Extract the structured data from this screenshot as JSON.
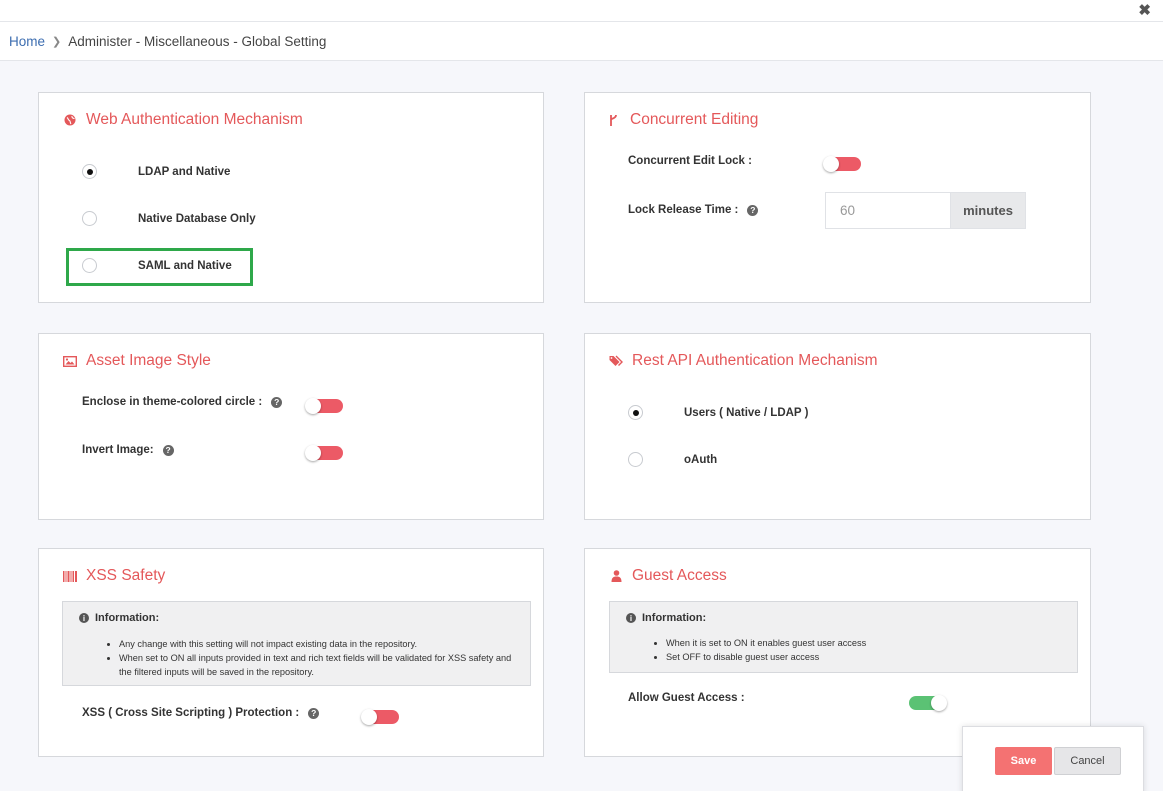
{
  "breadcrumb": {
    "home": "Home",
    "current": "Administer - Miscellaneous - Global Setting"
  },
  "icons": {
    "close": "close-icon",
    "web_auth": "globe-icon",
    "concurrent": "code-fork-icon",
    "asset_image": "image-icon",
    "rest_api": "tags-icon",
    "xss": "barcode-icon",
    "guest": "user-icon",
    "help": "question-circle-icon",
    "info": "info-circle-icon"
  },
  "colors": {
    "accent": "#e4585a",
    "toggle_off": "#ec5a66",
    "toggle_on": "#5bc274",
    "highlight": "#2ea84a",
    "save": "#f47272",
    "link": "#3c6db0"
  },
  "web_auth": {
    "title": "Web Authentication Mechanism",
    "options": [
      {
        "label": "LDAP and Native",
        "checked": true
      },
      {
        "label": "Native Database Only",
        "checked": false
      },
      {
        "label": "SAML and Native",
        "checked": false
      }
    ]
  },
  "concurrent": {
    "title": "Concurrent Editing",
    "lock_label": "Concurrent Edit Lock :",
    "lock_on": false,
    "release_label": "Lock Release Time :",
    "release_value": "60",
    "release_unit": "minutes"
  },
  "asset_image": {
    "title": "Asset Image Style",
    "enclose_label": "Enclose in theme-colored circle :",
    "enclose_on": false,
    "invert_label": "Invert Image:",
    "invert_on": false
  },
  "rest_api": {
    "title": "Rest API Authentication Mechanism",
    "options": [
      {
        "label": "Users ( Native / LDAP )",
        "checked": true
      },
      {
        "label": "oAuth",
        "checked": false
      }
    ]
  },
  "xss": {
    "title": "XSS Safety",
    "info_title": "Information:",
    "info_items": [
      "Any change with this setting will not impact existing data in the repository.",
      "When set to ON all inputs provided in text and rich text fields will be validated for XSS safety and the filtered inputs will be saved in the repository."
    ],
    "protection_label": "XSS ( Cross Site Scripting ) Protection :",
    "protection_on": false
  },
  "guest": {
    "title": "Guest Access",
    "info_title": "Information:",
    "info_items": [
      "When it is set to ON it enables guest user access",
      "Set OFF to disable guest user access"
    ],
    "allow_label": "Allow Guest Access :",
    "allow_on": true
  },
  "footer": {
    "save": "Save",
    "cancel": "Cancel"
  }
}
